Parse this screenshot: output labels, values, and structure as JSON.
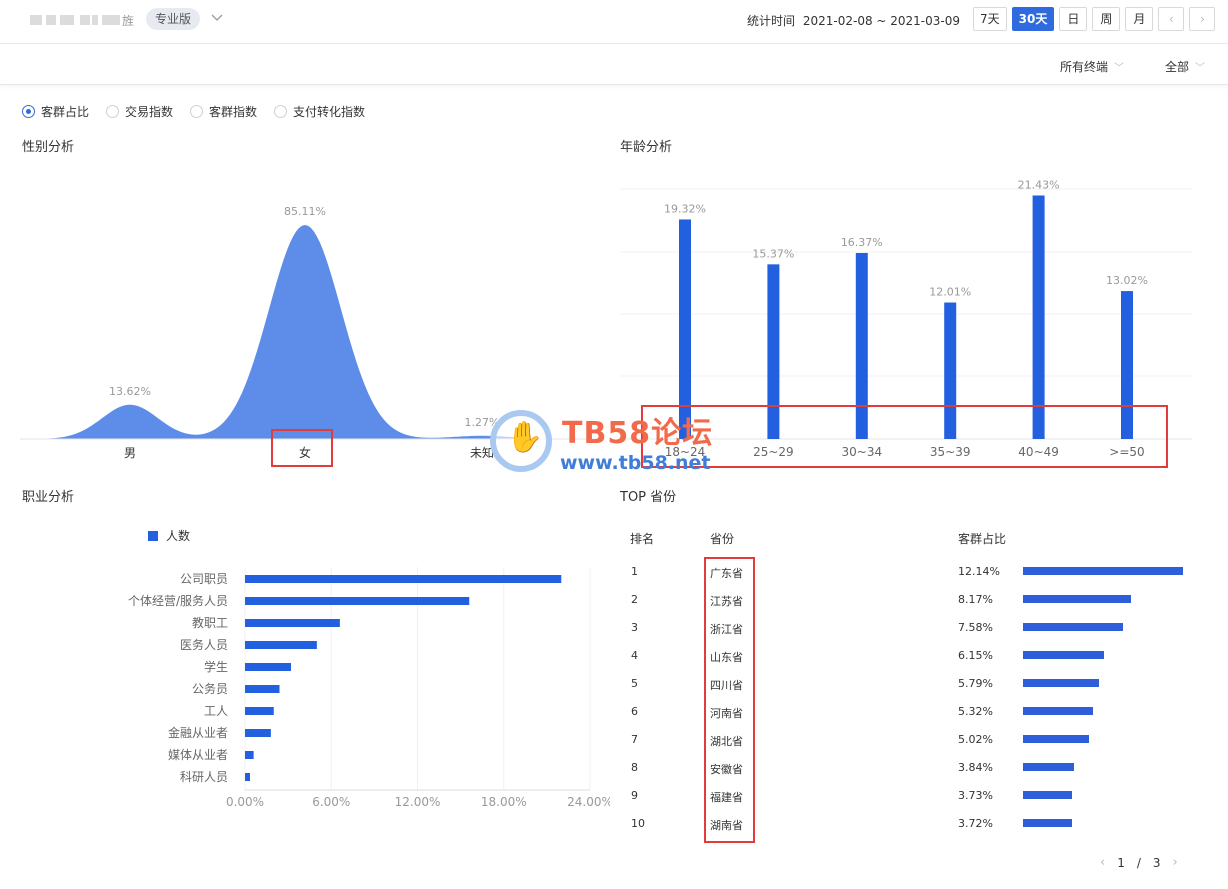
{
  "header": {
    "shop_name_tail": "旌",
    "edition_badge": "专业版",
    "stat_label": "统计时间",
    "date_range": "2021-02-08 ~ 2021-03-09",
    "time_buttons": [
      "7天",
      "30天",
      "日",
      "周",
      "月"
    ],
    "active_time_button": "30天",
    "prev_arrow": "‹",
    "next_arrow": "›"
  },
  "filters": {
    "terminal": "所有终端",
    "scope": "全部"
  },
  "tabs": [
    {
      "label": "客群占比",
      "selected": true
    },
    {
      "label": "交易指数",
      "selected": false
    },
    {
      "label": "客群指数",
      "selected": false
    },
    {
      "label": "支付转化指数",
      "selected": false
    }
  ],
  "gender": {
    "title": "性别分析",
    "chart_data": {
      "type": "area",
      "categories": [
        "男",
        "女",
        "未知"
      ],
      "values": [
        13.62,
        85.11,
        1.27
      ],
      "value_labels": [
        "13.62%",
        "85.11%",
        "1.27%"
      ],
      "color": "#5d8de8"
    }
  },
  "age": {
    "title": "年龄分析",
    "chart_data": {
      "type": "bar",
      "categories": [
        "18~24",
        "25~29",
        "30~34",
        "35~39",
        "40~49",
        ">=50"
      ],
      "values": [
        19.32,
        15.37,
        16.37,
        12.01,
        21.43,
        13.02
      ],
      "value_labels": [
        "19.32%",
        "15.37%",
        "16.37%",
        "12.01%",
        "21.43%",
        "13.02%"
      ],
      "color": "#2360e0",
      "grid": true
    }
  },
  "occupation": {
    "title": "职业分析",
    "legend": "人数",
    "chart_data": {
      "type": "bar",
      "orientation": "horizontal",
      "categories": [
        "公司职员",
        "个体经营/服务人员",
        "教职工",
        "医务人员",
        "学生",
        "公务员",
        "工人",
        "金融从业者",
        "媒体从业者",
        "科研人员"
      ],
      "values": [
        22.0,
        15.6,
        6.6,
        5.0,
        3.2,
        2.4,
        2.0,
        1.8,
        0.6,
        0.35
      ],
      "xlim": [
        0,
        24
      ],
      "tick_labels": [
        "0.00%",
        "6.00%",
        "12.00%",
        "18.00%",
        "24.00%"
      ],
      "tick_values": [
        0,
        6,
        12,
        18,
        24
      ],
      "color": "#2360e0",
      "grid": true
    }
  },
  "provinces": {
    "title": "TOP 省份",
    "columns": [
      "排名",
      "省份",
      "客群占比"
    ],
    "rows": [
      {
        "rank": "1",
        "name": "广东省",
        "pct": "12.14%",
        "value": 12.14
      },
      {
        "rank": "2",
        "name": "江苏省",
        "pct": "8.17%",
        "value": 8.17
      },
      {
        "rank": "3",
        "name": "浙江省",
        "pct": "7.58%",
        "value": 7.58
      },
      {
        "rank": "4",
        "name": "山东省",
        "pct": "6.15%",
        "value": 6.15
      },
      {
        "rank": "5",
        "name": "四川省",
        "pct": "5.79%",
        "value": 5.79
      },
      {
        "rank": "6",
        "name": "河南省",
        "pct": "5.32%",
        "value": 5.32
      },
      {
        "rank": "7",
        "name": "湖北省",
        "pct": "5.02%",
        "value": 5.02
      },
      {
        "rank": "8",
        "name": "安徽省",
        "pct": "3.84%",
        "value": 3.84
      },
      {
        "rank": "9",
        "name": "福建省",
        "pct": "3.73%",
        "value": 3.73
      },
      {
        "rank": "10",
        "name": "湖南省",
        "pct": "3.72%",
        "value": 3.72
      }
    ],
    "pager": {
      "current": "1",
      "separator": "/",
      "total": "3",
      "prev": "‹",
      "next": "›"
    }
  },
  "watermark": {
    "title": "TB58论坛",
    "url": "www.tb58.net",
    "hand": "✋"
  },
  "colors": {
    "accent": "#2f6bdf",
    "highlight_box": "#e23b3b"
  }
}
